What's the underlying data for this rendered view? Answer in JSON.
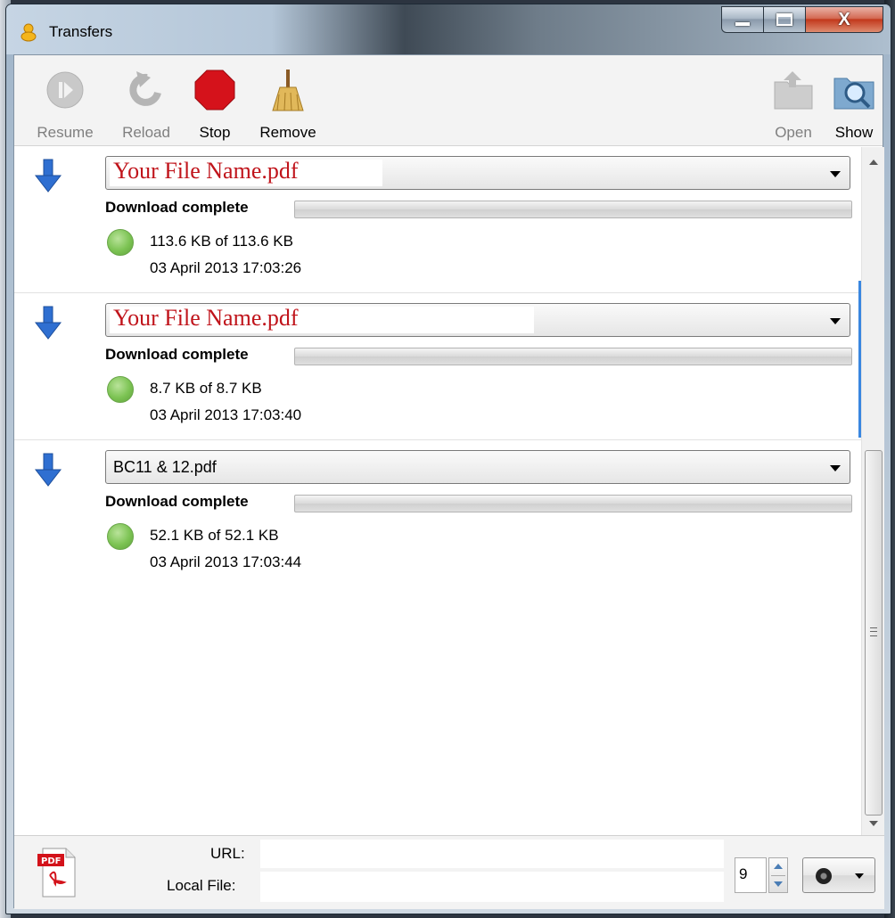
{
  "window": {
    "title": "Transfers"
  },
  "toolbar": {
    "resume_label": "Resume",
    "reload_label": "Reload",
    "stop_label": "Stop",
    "remove_label": "Remove",
    "open_label": "Open",
    "show_label": "Show"
  },
  "transfers": [
    {
      "filename": "Your File Name.pdf",
      "status": "Download complete",
      "size": "113.6 KB of 113.6 KB",
      "date": "03 April 2013 17:03:26"
    },
    {
      "filename": "Your File Name.pdf",
      "status": "Download complete",
      "size": "8.7 KB of 8.7 KB",
      "date": "03 April 2013 17:03:40"
    },
    {
      "filename": "BC11 & 12.pdf",
      "status": "Download complete",
      "size": "52.1 KB of 52.1 KB",
      "date": "03 April 2013 17:03:44"
    }
  ],
  "footer": {
    "url_label": "URL:",
    "local_file_label": "Local File:",
    "url_value": "",
    "local_file_value": "",
    "connections_value": "9",
    "pdf_icon_label": "PDF"
  },
  "colors": {
    "filename_accent": "#c0141b",
    "status_dot": "#7cc353",
    "arrow_blue": "#2f6fd1",
    "stop_red": "#d5121b"
  }
}
